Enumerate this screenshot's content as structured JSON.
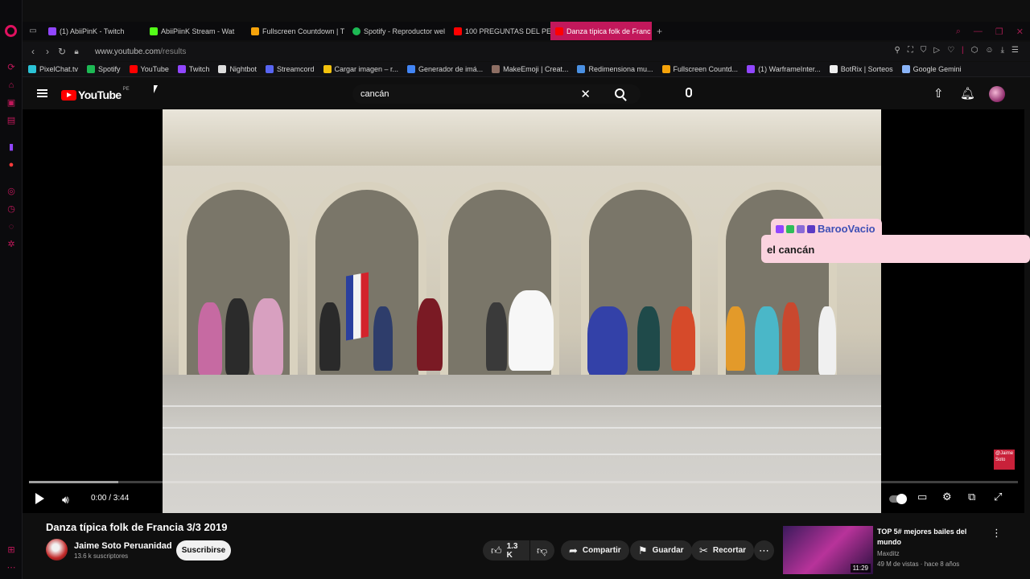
{
  "browser": {
    "tabs": [
      {
        "label": "(1) AbiiPinK - Twitch",
        "color": "#9146ff"
      },
      {
        "label": "AbiiPiinK Stream - Wat",
        "color": "#53fc18"
      },
      {
        "label": "Fullscreen Countdown | T",
        "color": "#f6a30a"
      },
      {
        "label": "Spotify - Reproductor wel",
        "color": "#1db954"
      },
      {
        "label": "100 PREGUNTAS DEL PER",
        "color": "#ff0000"
      },
      {
        "label": "Danza típica folk de Franc",
        "color": "#ff0000"
      }
    ],
    "url_host": "www.youtube.com",
    "url_path": "/results",
    "bookmarks": [
      {
        "label": "PixelChat.tv",
        "color": "#2bc3d6"
      },
      {
        "label": "Spotify",
        "color": "#1db954"
      },
      {
        "label": "YouTube",
        "color": "#ff0000"
      },
      {
        "label": "Twitch",
        "color": "#9146ff"
      },
      {
        "label": "Nightbot",
        "color": "#dddddd"
      },
      {
        "label": "Streamcord",
        "color": "#5865f2"
      },
      {
        "label": "Cargar imagen – r...",
        "color": "#f4c20d"
      },
      {
        "label": "Generador de imá...",
        "color": "#4285f4"
      },
      {
        "label": "MakeEmoji | Creat...",
        "color": "#8d6e63"
      },
      {
        "label": "Redimensiona mu...",
        "color": "#4a90e2"
      },
      {
        "label": "Fullscreen Countd...",
        "color": "#f6a30a"
      },
      {
        "label": "(1) WarframeInter...",
        "color": "#9146ff"
      },
      {
        "label": "BotRix | Sorteos",
        "color": "#eeeeee"
      },
      {
        "label": "Google Gemini",
        "color": "#8ab4f8"
      }
    ]
  },
  "youtube": {
    "logo_text": "YouTube",
    "country_code": "PE",
    "search_value": "cancán",
    "player": {
      "time": "0:00 / 3:44",
      "progress_fraction": 0.0,
      "buffered_fraction": 0.09
    },
    "overlay": {
      "chat_user": "BarooVacio",
      "chat_message": "el cancán",
      "watermark": "@Jaime Soto"
    },
    "video": {
      "title": "Danza típica folk de Francia 3/3 2019",
      "channel": "Jaime Soto Peruanidad",
      "subscribers": "13.6 k suscriptores",
      "subscribe_label": "Suscribirse",
      "likes": "1.3 K",
      "share_label": "Compartir",
      "save_label": "Guardar",
      "clip_label": "Recortar"
    },
    "recommended": {
      "title": "TOP 5# mejores bailes del mundo",
      "channel": "Maxditz",
      "meta": "49 M de vistas · hace 8 años",
      "duration": "11:29"
    }
  }
}
